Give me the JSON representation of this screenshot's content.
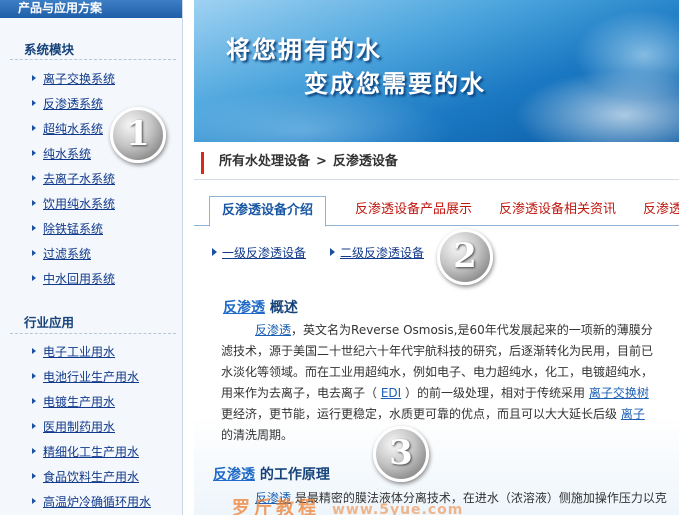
{
  "sidebar": {
    "header": "产品与应用方案",
    "sections": [
      {
        "title": "系统模块",
        "items": [
          "离子交换系统",
          "反渗透系统",
          "超纯水系统",
          "纯水系统",
          "去离子水系统",
          "饮用纯水系统",
          "除铁锰系统",
          "过滤系统",
          "中水回用系统"
        ]
      },
      {
        "title": "行业应用",
        "items": [
          "电子工业用水",
          "电池行业生产用水",
          "电镀生产用水",
          "医用制药用水",
          "精细化工生产用水",
          "食品饮料生产用水",
          "高温炉冷确循环用水"
        ]
      }
    ]
  },
  "banner": {
    "line1": "将您拥有的水",
    "line2": "变成您需要的水"
  },
  "breadcrumb": {
    "parent": "所有水处理设备",
    "separator": ">",
    "current": "反渗透设备"
  },
  "tabs": [
    "反渗透设备介绍",
    "反渗透设备产品展示",
    "反渗透设备相关资讯",
    "反渗透"
  ],
  "sublinks": [
    "一级反渗透设备",
    "二级反渗透设备"
  ],
  "overview": {
    "keyword": "反渗透",
    "heading_rest": " 概述",
    "lines": [
      {
        "link": "反渗透",
        "text": "，英文名为Reverse Osmosis,是60年代发展起来的一项新的薄膜分"
      },
      {
        "text": "滤技术，源于美国二十世纪六十年代宇航科技的研究，后逐渐转化为民用，目前已"
      },
      {
        "text": "水淡化等领域。而在工业用超纯水，例如电子、电力超纯水，化工，电镀超纯水，"
      },
      {
        "pre": "用来作为去离子，电去离子（ ",
        "link": "EDI",
        "post": " ）的前一级处理，相对于传统采用 ",
        "link2": "离子交换树"
      },
      {
        "pre": "更经济，更节能，运行更稳定，水质更可靠的优点，而且可以大大延长后级 ",
        "link": "离子"
      },
      {
        "text": "的清洗周期。"
      }
    ]
  },
  "principle": {
    "keyword": "反渗透",
    "heading_rest": " 的工作原理",
    "lines": [
      {
        "link": "反渗透",
        "text": " 是最精密的膜法液体分离技术，在进水（浓溶液）侧施加操作压力以克"
      }
    ]
  },
  "badges": [
    "1",
    "2",
    "3"
  ],
  "watermark": {
    "text": "罗斤教程",
    "url": "www.5yue.com"
  },
  "colors": {
    "sidebar_header": "#2a6bb6",
    "link": "#113a8c",
    "tab_other": "#c0170e",
    "breadcrumb_marker": "#d9291c"
  }
}
